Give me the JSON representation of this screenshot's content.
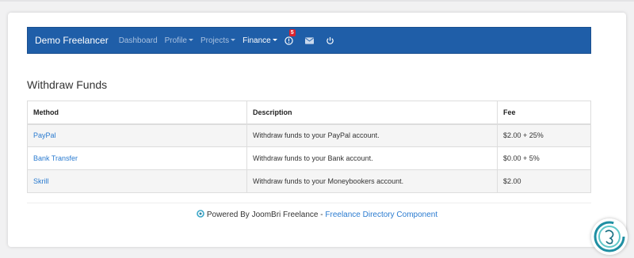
{
  "navbar": {
    "brand": "Demo Freelancer",
    "items": [
      {
        "label": "Dashboard"
      },
      {
        "label": "Profile"
      },
      {
        "label": "Projects"
      },
      {
        "label": "Finance"
      }
    ],
    "notification_count": "5",
    "icons": [
      "alert-icon",
      "envelope-icon",
      "power-icon"
    ]
  },
  "page": {
    "title": "Withdraw Funds"
  },
  "table": {
    "headers": [
      "Method",
      "Description",
      "Fee"
    ],
    "rows": [
      {
        "method": "PayPal",
        "description": "Withdraw funds to your PayPal account.",
        "fee": "$2.00 + 25%"
      },
      {
        "method": "Bank Transfer",
        "description": "Withdraw funds to your Bank account.",
        "fee": "$0.00 + 5%"
      },
      {
        "method": "Skrill",
        "description": "Withdraw funds to your Moneybookers account.",
        "fee": "$2.00"
      }
    ]
  },
  "footer": {
    "text": "Powered By JoomBri Freelance - ",
    "link": "Freelance Directory Component"
  },
  "colors": {
    "navbar": "#1f5ea8",
    "link": "#2a7bd0",
    "badge": "#d9232e"
  }
}
